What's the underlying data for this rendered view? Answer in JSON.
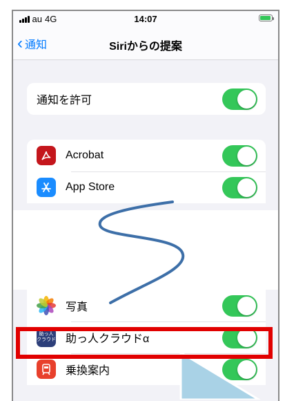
{
  "status": {
    "carrier": "au",
    "network": "4G",
    "time": "14:07"
  },
  "nav": {
    "back_label": "通知",
    "title": "Siriからの提案"
  },
  "allow_notifications": {
    "label": "通知を許可",
    "on": true
  },
  "apps_top": [
    {
      "name": "Acrobat",
      "icon": "acrobat-icon",
      "color": "#c4161c",
      "on": true
    },
    {
      "name": "App Store",
      "icon": "app-store-icon",
      "color": "#1a8cff",
      "on": true
    }
  ],
  "apps_bottom": [
    {
      "name": "写真",
      "icon": "photos-icon",
      "on": true
    },
    {
      "name": "助っ人クラウドα",
      "icon": "sukettonin-cloud-icon",
      "color": "#2d3f7a",
      "icon_text": "助っ人\nクラウド",
      "on": true
    },
    {
      "name": "乗換案内",
      "icon": "transit-icon",
      "color": "#e8402c",
      "on": true
    }
  ],
  "colors": {
    "accent": "#007aff",
    "toggle_on": "#34c759",
    "highlight": "#e10000"
  }
}
